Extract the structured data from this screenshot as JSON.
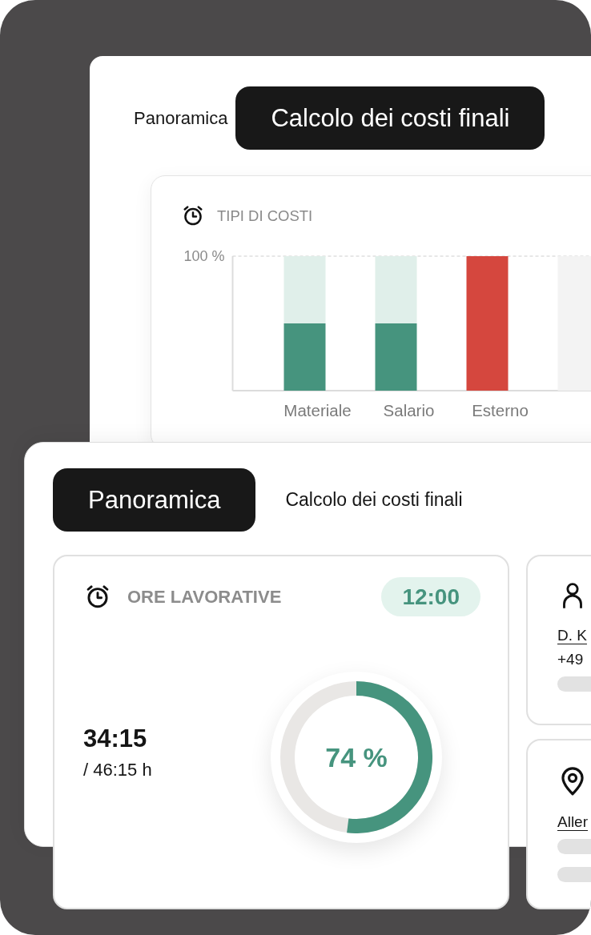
{
  "back_panel": {
    "tabs": [
      {
        "label": "Panoramica",
        "selected": false
      },
      {
        "label": "Calcolo dei costi finali",
        "selected": true
      }
    ],
    "cost_types": {
      "title": "TIPI DI COSTI",
      "chart_data": {
        "type": "bar",
        "stacked": true,
        "categories": [
          "Materiale",
          "Salario",
          "Esterno",
          null
        ],
        "ylim": [
          0,
          100
        ],
        "yticks": [
          {
            "value": 100,
            "label": "100 %"
          }
        ],
        "series": [
          {
            "color": "#46947e",
            "values": [
              50,
              50,
              null,
              null
            ]
          },
          {
            "color": "#e0efea",
            "values": [
              50,
              50,
              null,
              null
            ]
          },
          {
            "color": "#d5473e",
            "values": [
              null,
              null,
              100,
              null
            ]
          },
          {
            "color": "#f3f3f3",
            "values": [
              null,
              null,
              null,
              100
            ]
          }
        ]
      }
    }
  },
  "front_panel": {
    "tabs": [
      {
        "label": "Panoramica",
        "selected": true
      },
      {
        "label": "Calcolo dei costi finali",
        "selected": false
      }
    ],
    "work_hours": {
      "title": "ORE LAVORATIVE",
      "badge": "12:00",
      "logged": "34:15",
      "planned": "/ 46:15 h",
      "level": 0.52,
      "percent": "74 %"
    },
    "side_cards": [
      {
        "kind": "contact",
        "lines": [
          {
            "kind": "link",
            "text": "D. K"
          },
          {
            "kind": "text",
            "text": "+49"
          },
          {
            "kind": "placeholder"
          }
        ]
      },
      {
        "kind": "location",
        "lines": [
          {
            "kind": "link",
            "text": "Aller"
          },
          {
            "kind": "placeholder"
          },
          {
            "kind": "placeholder"
          }
        ]
      }
    ]
  }
}
